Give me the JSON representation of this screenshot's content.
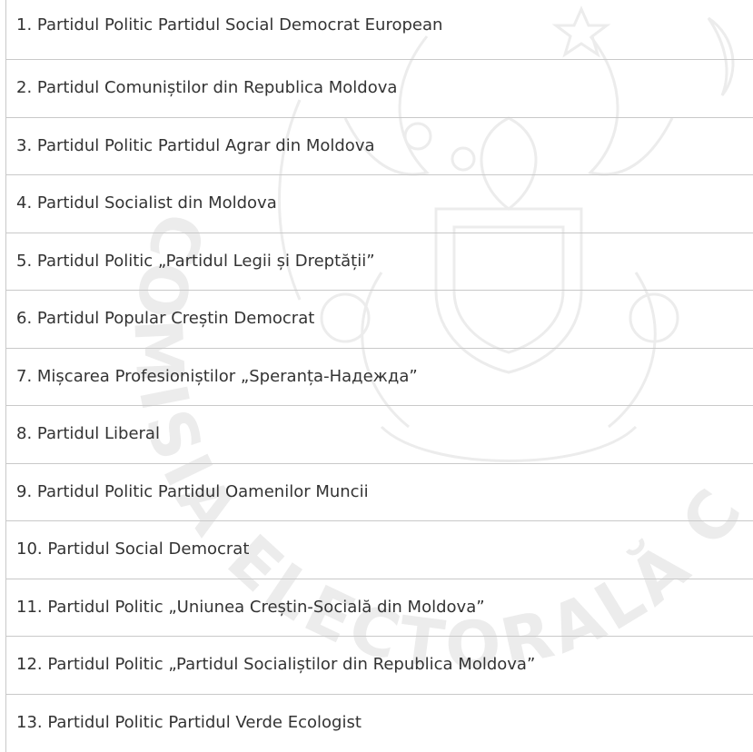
{
  "items": [
    "1. Partidul Politic Partidul Social Democrat European",
    "2. Partidul Comuniștilor din Republica Moldova",
    "3. Partidul Politic Partidul Agrar din Moldova",
    "4. Partidul Socialist din Moldova",
    "5. Partidul Politic „Partidul Legii și Dreptății”",
    "6. Partidul Popular Creștin Democrat",
    "7. Mișcarea Profesioniștilor „Speranța-Надежда”",
    "8. Partidul Liberal",
    "9. Partidul Politic Partidul Oamenilor Muncii",
    "10. Partidul Social Democrat",
    "11. Partidul Politic „Uniunea Creștin-Socială din Moldova”",
    "12. Partidul Politic „Partidul Socialiștilor din Republica Moldova”",
    "13. Partidul Politic Partidul Verde Ecologist"
  ],
  "watermark": {
    "seal_text": "COMISIA ELECTORALĂ C",
    "color": "#ececec"
  },
  "colors": {
    "text": "#333333",
    "border": "#c9c9c9",
    "background": "#ffffff"
  }
}
